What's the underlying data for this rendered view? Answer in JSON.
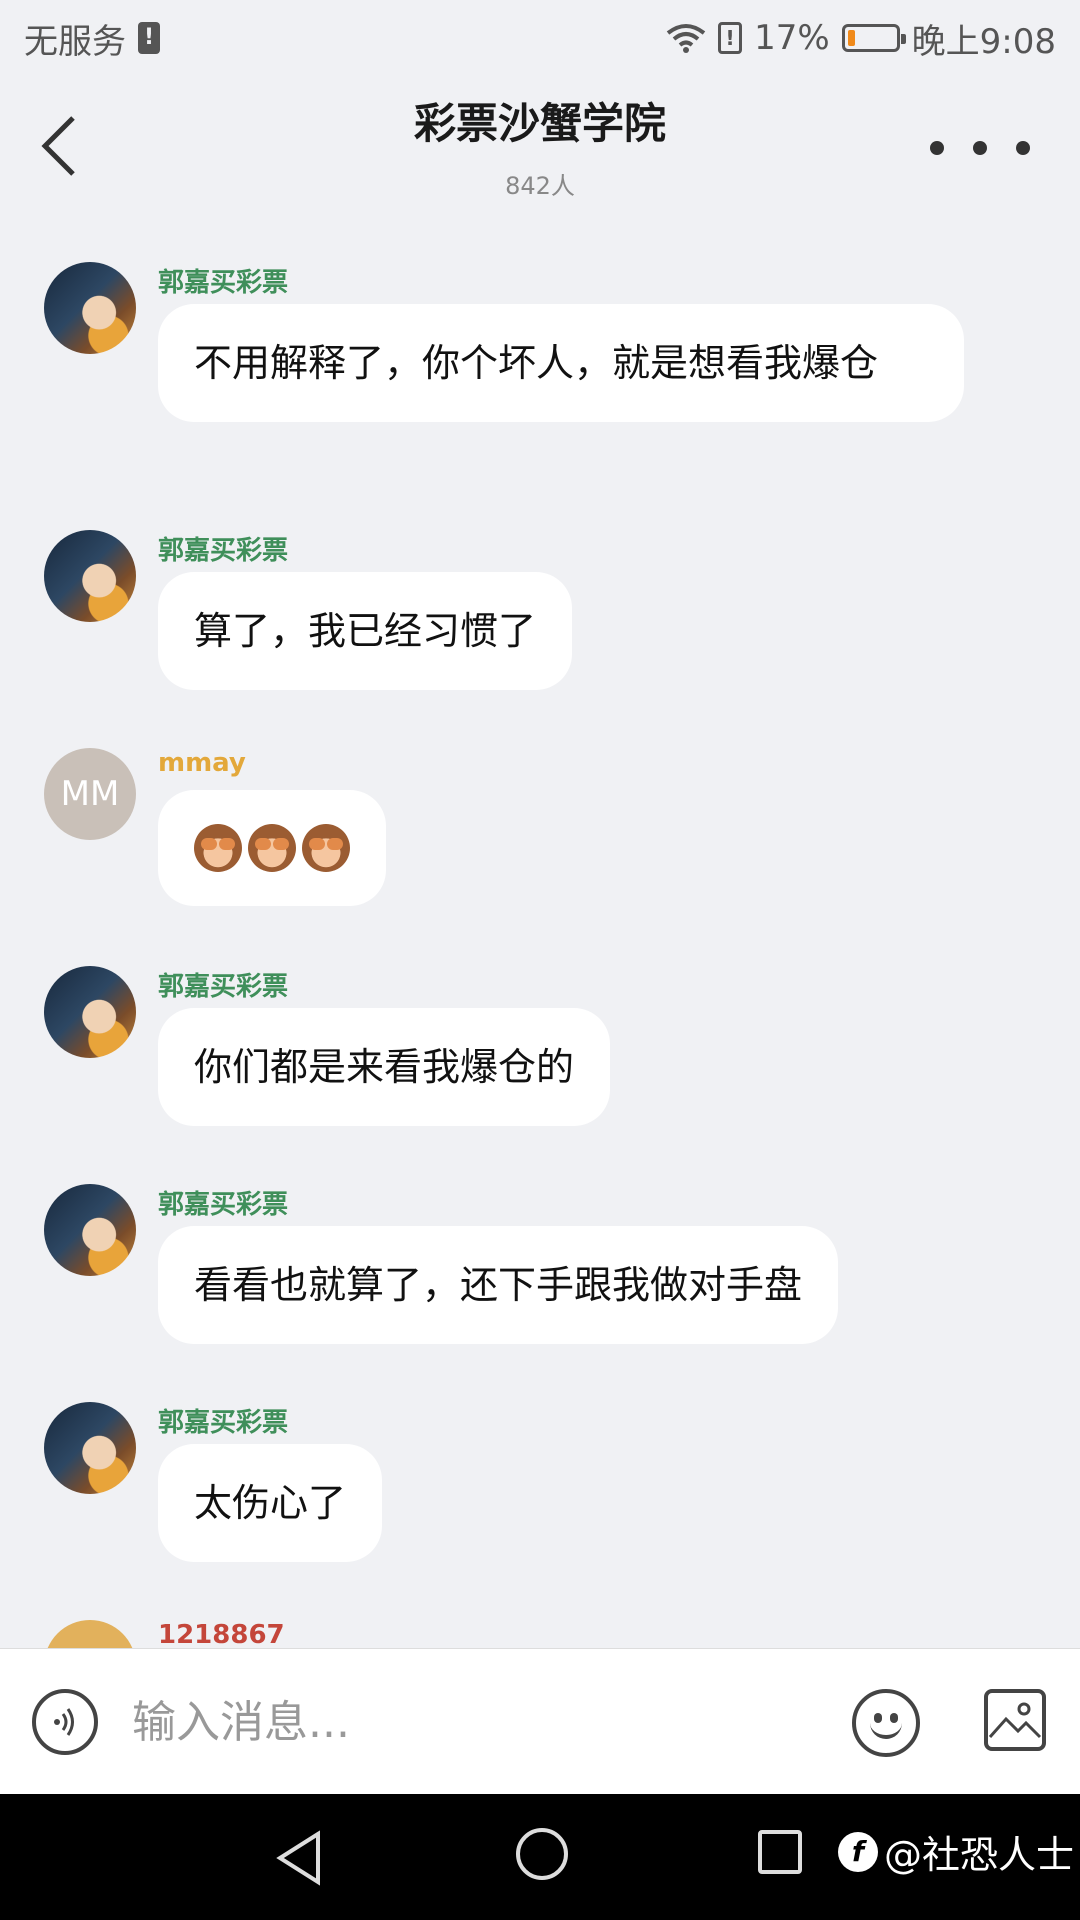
{
  "status_bar": {
    "carrier": "无服务",
    "battery_percent": "17%",
    "battery_level": 0.17,
    "time": "晚上9:08"
  },
  "header": {
    "title": "彩票沙蟹学院",
    "member_count": "842人"
  },
  "colors": {
    "sender_green": "#3f8f5a",
    "sender_orange": "#e3a83a",
    "sender_red": "#c4463a"
  },
  "messages": [
    {
      "sender": "郭嘉买彩票",
      "text": "不用解释了，你个坏人，就是想看我爆仓"
    },
    {
      "sender": "郭嘉买彩票",
      "text": "算了，我已经习惯了"
    },
    {
      "sender": "mmay",
      "avatar_text": "MM",
      "emoji": [
        "see-no-evil-monkey",
        "see-no-evil-monkey",
        "see-no-evil-monkey"
      ]
    },
    {
      "sender": "郭嘉买彩票",
      "text": "你们都是来看我爆仓的"
    },
    {
      "sender": "郭嘉买彩票",
      "text": "看看也就算了，还下手跟我做对手盘"
    },
    {
      "sender": "郭嘉买彩票",
      "text": "太伤心了"
    },
    {
      "sender": "1218867"
    }
  ],
  "input": {
    "placeholder": "输入消息..."
  },
  "watermark": {
    "text": "@社恐人士"
  }
}
